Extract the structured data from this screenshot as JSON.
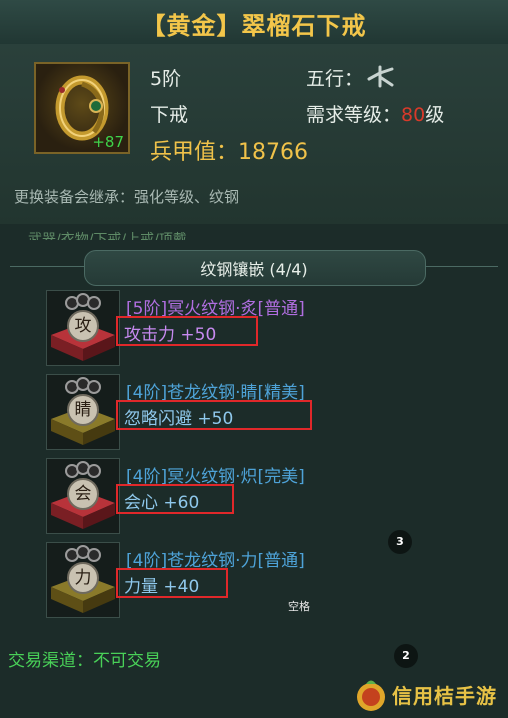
{
  "title": "【黄金】翠榴石下戒",
  "item": {
    "plus": "+87",
    "tier": "5阶",
    "slot": "下戒",
    "element_label": "五行：",
    "element_icon": "water-glyph",
    "req_label": "需求等级：",
    "req_level": "80",
    "req_unit": "级",
    "power_label": "兵甲值：",
    "power_value": "18766"
  },
  "inherit_text": "更换装备会继承：强化等级、纹钢",
  "tabs_fragment": "武器/衣物/下戒/上戒/项戴",
  "section_title": "纹钢镶嵌 (4/4)",
  "gems": [
    {
      "char": "攻",
      "name": "[5阶]冥火纹钢·炙[普通]",
      "stat": "攻击力  +50",
      "name_color": "#b06ee0",
      "stat_color": "#c78af0"
    },
    {
      "char": "睛",
      "name": "[4阶]苍龙纹钢·睛[精美]",
      "stat": "忽略闪避  +50",
      "name_color": "#4ea3d8",
      "stat_color": "#8fc8ec"
    },
    {
      "char": "会",
      "name": "[4阶]冥火纹钢·炽[完美]",
      "stat": "会心  +60",
      "name_color": "#4ea3d8",
      "stat_color": "#8fc8ec"
    },
    {
      "char": "力",
      "name": "[4阶]苍龙纹钢·力[普通]",
      "stat": "力量  +40",
      "name_color": "#4ea3d8",
      "stat_color": "#8fc8ec"
    }
  ],
  "trade_text": "交易渠道：不可交易",
  "badges": {
    "badge_a": "3",
    "badge_b": "2"
  },
  "space_hint": "空格",
  "watermark": "信用桔手游",
  "colors": {
    "gold": "#f3c64a",
    "req_red": "#d83a2a",
    "trade_green": "#49d158",
    "box_red": "#e0282a"
  }
}
